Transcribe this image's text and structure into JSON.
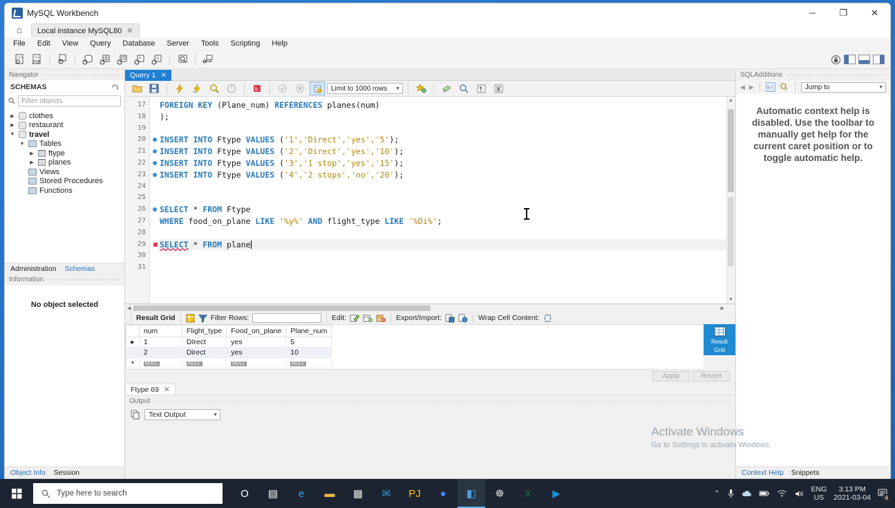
{
  "window": {
    "app_title": "MySQL Workbench",
    "minimize": "─",
    "maximize": "❐",
    "close": "✕",
    "home_icon": "home-icon",
    "instance_tab": "Local instance MySQL80",
    "tab_close": "✕"
  },
  "menu": [
    "File",
    "Edit",
    "View",
    "Query",
    "Database",
    "Server",
    "Tools",
    "Scripting",
    "Help"
  ],
  "navigator": {
    "caption": "Navigator",
    "section": "SCHEMAS",
    "refresh_icon": "refresh-icon",
    "filter_placeholder": "Filter objects",
    "search_icon": "search-icon",
    "tree": [
      {
        "label": "clothes",
        "indent": 0,
        "arrow": "▶",
        "icon": "schema-icon",
        "bold": false
      },
      {
        "label": "restaurant",
        "indent": 0,
        "arrow": "▶",
        "icon": "schema-icon",
        "bold": false
      },
      {
        "label": "travel",
        "indent": 0,
        "arrow": "▼",
        "icon": "schema-icon",
        "bold": true
      },
      {
        "label": "Tables",
        "indent": 1,
        "arrow": "▼",
        "icon": "folder-icon",
        "bold": false
      },
      {
        "label": "ftype",
        "indent": 2,
        "arrow": "▶",
        "icon": "table-icon",
        "bold": false
      },
      {
        "label": "planes",
        "indent": 2,
        "arrow": "▶",
        "icon": "table-icon",
        "bold": false
      },
      {
        "label": "Views",
        "indent": 1,
        "arrow": "",
        "icon": "folder-icon",
        "bold": false
      },
      {
        "label": "Stored Procedures",
        "indent": 1,
        "arrow": "",
        "icon": "folder-icon",
        "bold": false
      },
      {
        "label": "Functions",
        "indent": 1,
        "arrow": "",
        "icon": "folder-icon",
        "bold": false
      }
    ],
    "tabs": [
      {
        "label": "Administration",
        "active": false
      },
      {
        "label": "Schemas",
        "active": true
      }
    ],
    "information_caption": "Information",
    "no_object": "No object selected",
    "bottom_tabs": [
      {
        "label": "Object Info",
        "active": true
      },
      {
        "label": "Session",
        "active": false
      }
    ]
  },
  "editor": {
    "query_tab": "Query 1",
    "query_tab_close": "✕",
    "limit_selector": "Limit to 1000 rows",
    "toolbar_icons": [
      "open-script-icon",
      "save-script-icon",
      "execute-icon",
      "execute-current-icon",
      "explain-icon",
      "stop-icon",
      "toggle-breakpoint-icon",
      "continue-icon",
      "stop-debug-icon",
      "toggle-autocommit-icon",
      "star-icon",
      "beautify-icon",
      "find-icon",
      "invisible-chars-icon",
      "wrap-lines-icon"
    ],
    "lines": [
      {
        "no": "17",
        "mark": "",
        "tokens": [
          {
            "t": "FOREIGN KEY ",
            "c": "kw"
          },
          {
            "t": "(Plane_num) ",
            "c": "plain"
          },
          {
            "t": "REFERENCES ",
            "c": "kw"
          },
          {
            "t": "planes(num)",
            "c": "plain"
          }
        ]
      },
      {
        "no": "18",
        "mark": "",
        "tokens": [
          {
            "t": ");",
            "c": "plain"
          }
        ]
      },
      {
        "no": "19",
        "mark": "",
        "tokens": []
      },
      {
        "no": "20",
        "mark": "dot",
        "tokens": [
          {
            "t": "INSERT INTO ",
            "c": "kw"
          },
          {
            "t": "Ftype ",
            "c": "plain"
          },
          {
            "t": "VALUES ",
            "c": "kw"
          },
          {
            "t": "(",
            "c": "plain"
          },
          {
            "t": "'1','Direct','yes','5'",
            "c": "str"
          },
          {
            "t": ");",
            "c": "plain"
          }
        ]
      },
      {
        "no": "21",
        "mark": "dot",
        "tokens": [
          {
            "t": "INSERT INTO ",
            "c": "kw"
          },
          {
            "t": "Ftype ",
            "c": "plain"
          },
          {
            "t": "VALUES ",
            "c": "kw"
          },
          {
            "t": "(",
            "c": "plain"
          },
          {
            "t": "'2','Direct','yes','10'",
            "c": "str"
          },
          {
            "t": ");",
            "c": "plain"
          }
        ]
      },
      {
        "no": "22",
        "mark": "dot",
        "tokens": [
          {
            "t": "INSERT INTO ",
            "c": "kw"
          },
          {
            "t": "Ftype ",
            "c": "plain"
          },
          {
            "t": "VALUES ",
            "c": "kw"
          },
          {
            "t": "(",
            "c": "plain"
          },
          {
            "t": "'3','1 stop','yes','15'",
            "c": "str"
          },
          {
            "t": ");",
            "c": "plain"
          }
        ]
      },
      {
        "no": "23",
        "mark": "dot",
        "tokens": [
          {
            "t": "INSERT INTO ",
            "c": "kw"
          },
          {
            "t": "Ftype ",
            "c": "plain"
          },
          {
            "t": "VALUES ",
            "c": "kw"
          },
          {
            "t": "(",
            "c": "plain"
          },
          {
            "t": "'4','2 stops','no','20'",
            "c": "str"
          },
          {
            "t": ");",
            "c": "plain"
          }
        ]
      },
      {
        "no": "24",
        "mark": "",
        "tokens": []
      },
      {
        "no": "25",
        "mark": "",
        "tokens": []
      },
      {
        "no": "26",
        "mark": "dot",
        "tokens": [
          {
            "t": "SELECT ",
            "c": "kw"
          },
          {
            "t": "* ",
            "c": "plain"
          },
          {
            "t": "FROM ",
            "c": "kw"
          },
          {
            "t": "Ftype",
            "c": "plain"
          }
        ]
      },
      {
        "no": "27",
        "mark": "",
        "tokens": [
          {
            "t": "WHERE ",
            "c": "kw"
          },
          {
            "t": "food_on_plane ",
            "c": "plain"
          },
          {
            "t": "LIKE ",
            "c": "kw"
          },
          {
            "t": "'%y%' ",
            "c": "str"
          },
          {
            "t": "AND ",
            "c": "kw"
          },
          {
            "t": "flight_type ",
            "c": "plain"
          },
          {
            "t": "LIKE ",
            "c": "kw"
          },
          {
            "t": "'%Di%'",
            "c": "str"
          },
          {
            "t": ";",
            "c": "plain"
          }
        ]
      },
      {
        "no": "28",
        "mark": "",
        "tokens": []
      },
      {
        "no": "29",
        "mark": "err",
        "current": true,
        "tokens": [
          {
            "t": "SELECT",
            "c": "kw err-u"
          },
          {
            "t": " * ",
            "c": "plain"
          },
          {
            "t": "FROM ",
            "c": "kw"
          },
          {
            "t": "plane",
            "c": "plain"
          }
        ],
        "caret": true
      },
      {
        "no": "30",
        "mark": "",
        "tokens": []
      },
      {
        "no": "31",
        "mark": "",
        "tokens": []
      }
    ]
  },
  "results": {
    "toolbar": {
      "result_grid_label": "Result Grid",
      "grid_icon": "grid-view-icon",
      "filter_icon": "filter-icon",
      "filter_rows_label": "Filter Rows:",
      "filter_rows_value": "",
      "edit_label": "Edit:",
      "edit_icons": [
        "edit-cell-icon",
        "insert-row-icon",
        "delete-row-icon"
      ],
      "export_label": "Export/Import:",
      "export_icons": [
        "export-recordset-icon",
        "import-recordset-icon"
      ],
      "wrap_label": "Wrap Cell Content:",
      "wrap_icon": "wrap-cell-icon"
    },
    "columns": [
      "num",
      "Flight_type",
      "Food_on_plane",
      "Plane_num"
    ],
    "rows": [
      {
        "marker": "▶",
        "cells": [
          "1",
          "DIrect",
          "yes",
          "5"
        ]
      },
      {
        "marker": "",
        "cells": [
          "2",
          "Direct",
          "yes",
          "10"
        ]
      },
      {
        "marker": "✶",
        "cells": [
          "NULL",
          "NULL",
          "NULL",
          "NULL"
        ],
        "is_null": true
      }
    ],
    "side_button": {
      "line1": "Result",
      "line2": "Grid",
      "icon": "result-grid-icon"
    },
    "apply_label": "Apply",
    "revert_label": "Revert",
    "result_tab": "Ftype 69",
    "result_tab_close": "✕"
  },
  "output": {
    "caption": "Output",
    "copy_icon": "copy-icon",
    "mode": "Text Output"
  },
  "sql_additions": {
    "caption": "SQLAdditions",
    "back_icon": "back-arrow-icon",
    "forward_icon": "forward-arrow-icon",
    "help_icon": "context-help-icon",
    "auto_help_icon": "toggle-auto-help-icon",
    "jump_to": "Jump to",
    "message": "Automatic context help is disabled. Use the toolbar to manually get help for the current caret position or to toggle automatic help.",
    "tabs": [
      {
        "label": "Context Help",
        "active": true
      },
      {
        "label": "Snippets",
        "active": false
      }
    ]
  },
  "watermark": {
    "title": "Activate Windows",
    "subtitle": "Go to Settings to activate Windows."
  },
  "taskbar": {
    "start_icon": "windows-start-icon",
    "search_icon": "search-icon",
    "search_placeholder": "Type here to search",
    "apps": [
      {
        "name": "cortana-icon",
        "glyph": "O",
        "color": "#ffffff",
        "active": false
      },
      {
        "name": "task-view-icon",
        "glyph": "▤",
        "color": "#ffffff",
        "active": false
      },
      {
        "name": "edge-icon",
        "glyph": "e",
        "color": "#3aa0e6",
        "active": false
      },
      {
        "name": "file-explorer-icon",
        "glyph": "▬",
        "color": "#f3bb49",
        "active": false
      },
      {
        "name": "microsoft-store-icon",
        "glyph": "▦",
        "color": "#e8e8e8",
        "active": false
      },
      {
        "name": "mail-icon",
        "glyph": "✉",
        "color": "#2f9bdc",
        "active": false
      },
      {
        "name": "pycharm-icon",
        "glyph": "PJ",
        "color": "#f5c518",
        "active": false
      },
      {
        "name": "chrome-icon",
        "glyph": "●",
        "color": "#4285f4",
        "active": false
      },
      {
        "name": "mysql-workbench-icon",
        "glyph": "◧",
        "color": "#4aa3df",
        "active": true
      },
      {
        "name": "xampp-icon",
        "glyph": "☸",
        "color": "#dcdcdc",
        "active": false
      },
      {
        "name": "excel-icon",
        "glyph": "X",
        "color": "#1f7244",
        "active": false
      },
      {
        "name": "movies-tv-icon",
        "glyph": "▶",
        "color": "#1e8fd5",
        "active": false
      }
    ],
    "tray": {
      "chevron": "⌃",
      "icons": [
        "microphone-icon",
        "onedrive-icon",
        "battery-icon",
        "wifi-icon",
        "volume-icon"
      ],
      "language_line1": "ENG",
      "language_line2": "US",
      "time": "3:13 PM",
      "date": "2021-03-04",
      "notification_icon": "notification-icon",
      "notification_count": "4"
    }
  }
}
